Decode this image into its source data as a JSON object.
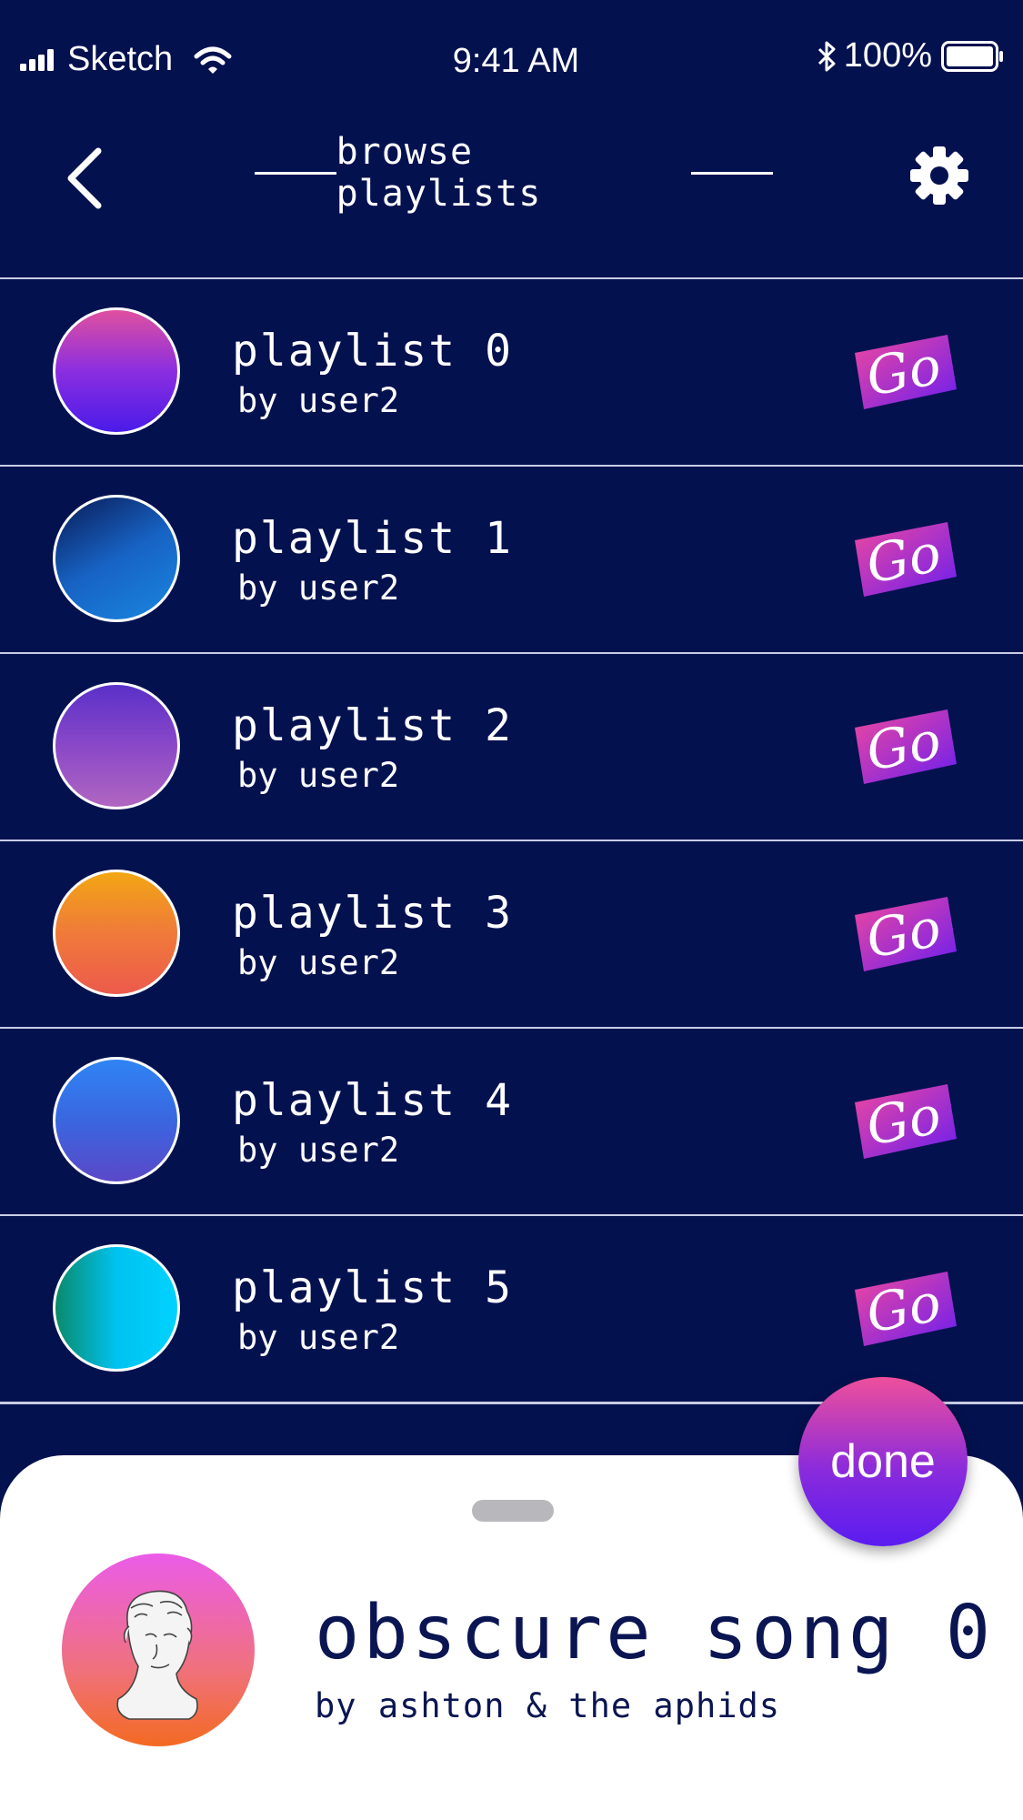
{
  "status_bar": {
    "carrier": "Sketch",
    "time": "9:41 AM",
    "battery": "100%"
  },
  "header": {
    "title": "browse playlists",
    "back_icon": "chevron-left-icon",
    "settings_icon": "gear-icon"
  },
  "playlists": [
    {
      "title": "playlist 0",
      "subtitle": "by user2",
      "gradient": [
        "#e0509f",
        "#8b2ee0",
        "#4a1be8"
      ]
    },
    {
      "title": "playlist 1",
      "subtitle": "by user2",
      "gradient": [
        "#0a1a55",
        "#1763c4",
        "#1a86e0"
      ]
    },
    {
      "title": "playlist 2",
      "subtitle": "by user2",
      "gradient": [
        "#5a30c8",
        "#8a48c8",
        "#b066c0"
      ]
    },
    {
      "title": "playlist 3",
      "subtitle": "by user2",
      "gradient": [
        "#f2a614",
        "#f07a3a",
        "#ec5a4c"
      ]
    },
    {
      "title": "playlist 4",
      "subtitle": "by user2",
      "gradient": [
        "#2f84f4",
        "#3a66e0",
        "#5a48c8"
      ]
    },
    {
      "title": "playlist 5",
      "subtitle": "by user2",
      "gradient": [
        "#0a8a6a",
        "#00c2f0",
        "#00d2ff"
      ]
    }
  ],
  "go_button": {
    "label": "Go",
    "colors": [
      "#f0489e",
      "#6a1ef0"
    ]
  },
  "done_button": {
    "label": "done"
  },
  "now_playing": {
    "title": "obscure song 0",
    "artist": "by ashton & the aphids"
  },
  "colors": {
    "background": "#03114f",
    "sheet": "#ffffff",
    "text_dark": "#0a1552"
  }
}
